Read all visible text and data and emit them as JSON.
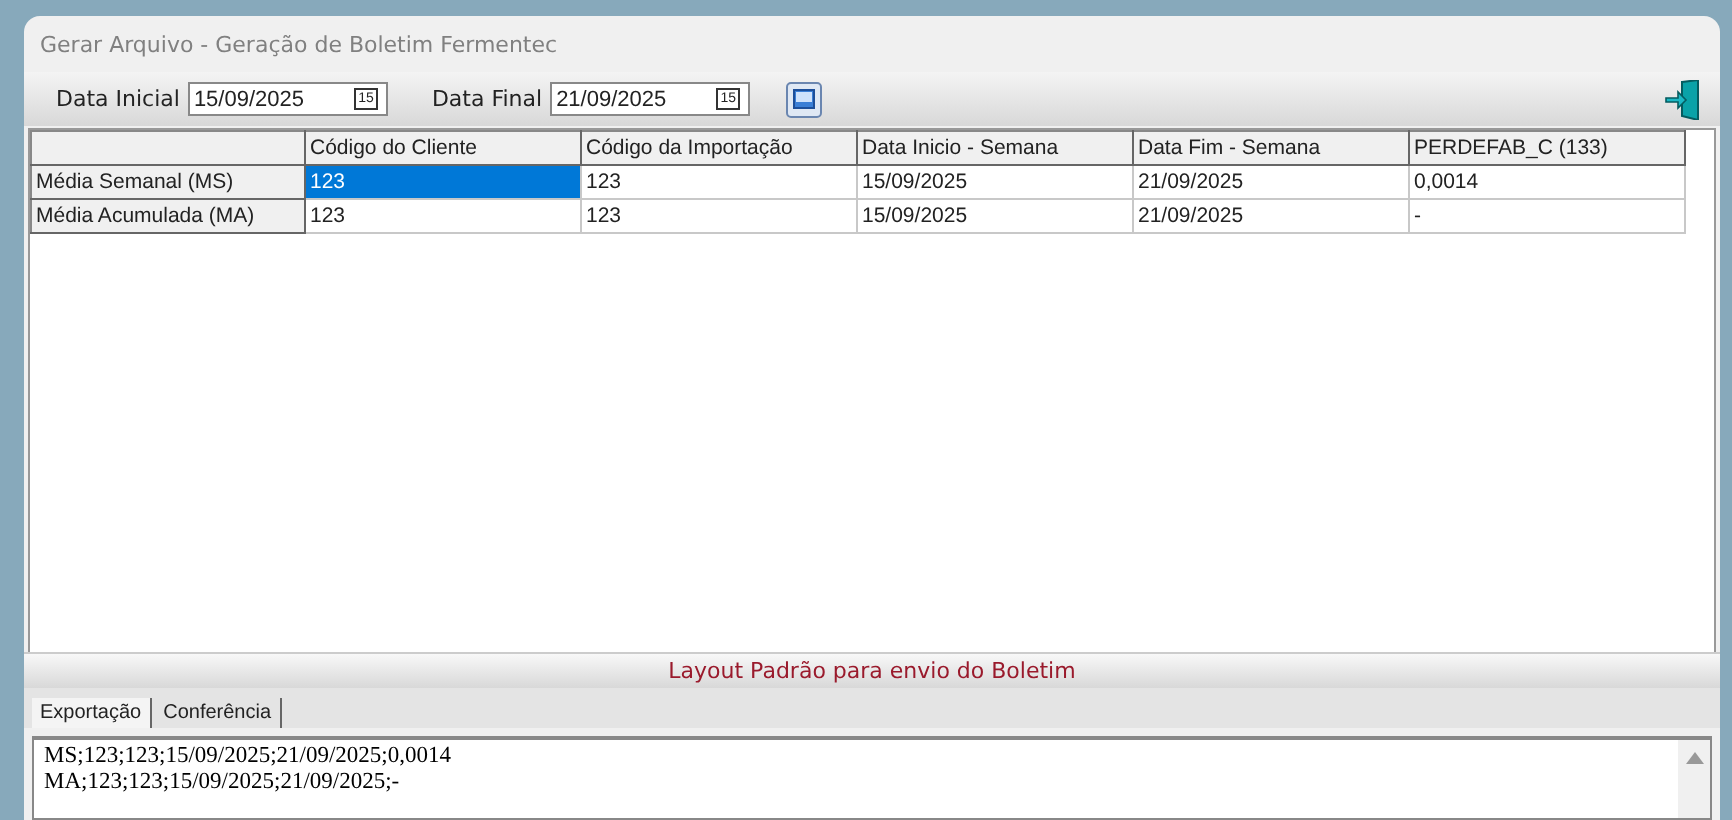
{
  "window": {
    "title": "Gerar Arquivo - Geração de Boletim Fermentec"
  },
  "toolbar": {
    "start_label": "Data Inicial",
    "start_value": "15/09/2025",
    "start_calendar": "15",
    "end_label": "Data Final",
    "end_value": "21/09/2025",
    "end_calendar": "15"
  },
  "table": {
    "columns": [
      "Código do Cliente",
      "Código da Importação",
      "Data Inicio - Semana",
      "Data Fim - Semana",
      "PERDEFAB_C (133)"
    ],
    "rows": [
      {
        "header": "Média Semanal (MS)",
        "cells": [
          {
            "text": "123",
            "selected": true
          },
          {
            "text": "123",
            "selected": false
          },
          {
            "text": "15/09/2025",
            "selected": false
          },
          {
            "text": "21/09/2025",
            "selected": false
          },
          {
            "text": "0,0014",
            "selected": false
          }
        ]
      },
      {
        "header": "Média Acumulada (MA)",
        "cells": [
          {
            "text": "123",
            "selected": false
          },
          {
            "text": "123",
            "selected": false
          },
          {
            "text": "15/09/2025",
            "selected": false
          },
          {
            "text": "21/09/2025",
            "selected": false
          },
          {
            "text": "-",
            "selected": false
          }
        ]
      }
    ]
  },
  "caption": "Layout Padrão para envio do Boletim",
  "tabs": [
    {
      "label": "Exportação",
      "selected": true
    },
    {
      "label": "Conferência",
      "selected": false
    }
  ],
  "output_lines": [
    "MS;123;123;15/09/2025;21/09/2025;0,0014",
    "MA;123;123;15/09/2025;21/09/2025;-"
  ]
}
